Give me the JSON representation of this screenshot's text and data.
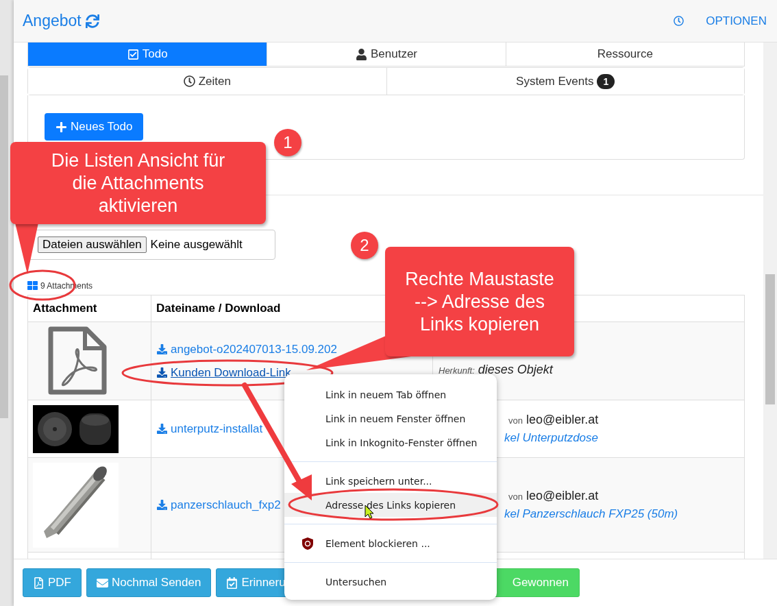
{
  "header": {
    "title": "Angebot",
    "options": "OPTIONEN"
  },
  "tabs": [
    [
      {
        "label": "Todo",
        "kind": "check",
        "selected": true
      },
      {
        "label": "Benutzer",
        "kind": "user",
        "selected": false
      },
      {
        "label": "Ressource",
        "kind": "plain",
        "selected": false
      }
    ],
    [
      {
        "label": "Zeiten",
        "kind": "clock",
        "selected": false
      },
      {
        "label": "System Events",
        "kind": "plain",
        "badge": "1",
        "selected": false
      }
    ]
  ],
  "todo_button": "Neues Todo",
  "file_input": {
    "button": "Dateien auswählen",
    "status": "Keine ausgewählt"
  },
  "attachments_count": "9 Attachments",
  "table": {
    "columns": [
      "Attachment",
      "Dateiname / Download"
    ],
    "rows": [
      {
        "kind": "pdf",
        "links": [
          {
            "text": "angebot-o202407013-15.09.202",
            "hovered": false
          },
          {
            "text": "Kunden Download-Link",
            "hovered": true
          }
        ],
        "info": {
          "kind": "origin",
          "label": "Herkunft:",
          "value": "dieses Objekt"
        }
      },
      {
        "kind": "boxes",
        "links": [
          {
            "text": "unterputz-installat",
            "hovered": false
          }
        ],
        "info": {
          "kind": "user",
          "label": "von",
          "value": "leo@eibler.at",
          "article": "kel Unterputzdose"
        }
      },
      {
        "kind": "hose",
        "links": [
          {
            "text": "panzerschlauch_fxp2",
            "hovered": false
          }
        ],
        "info": {
          "kind": "user",
          "label": "von",
          "value": "leo@eibler.at",
          "article": "kel Panzerschlauch FXP25 (50m)"
        }
      }
    ]
  },
  "footer_buttons": [
    {
      "label": "PDF",
      "kind": "pdf"
    },
    {
      "label": "Nochmal Senden",
      "kind": "mail"
    },
    {
      "label": "Erinneru",
      "kind": "calendar"
    },
    {
      "label": "Gewonnen",
      "kind": "success"
    }
  ],
  "context_menu": [
    [
      {
        "label": "Link in neuem Tab öffnen",
        "highlighted": false
      },
      {
        "label": "Link in neuem Fenster öffnen",
        "highlighted": false
      },
      {
        "label": "Link in Inkognito-Fenster öffnen",
        "highlighted": false
      }
    ],
    [
      {
        "label": "Link speichern unter...",
        "highlighted": false
      },
      {
        "label": "Adresse des Links kopieren",
        "highlighted": true
      }
    ],
    [
      {
        "label": "Element blockieren ...",
        "kind": "extension",
        "highlighted": false
      }
    ],
    [
      {
        "label": "Untersuchen",
        "highlighted": false
      }
    ]
  ],
  "callouts": [
    {
      "number": "1",
      "text": "Die Listen Ansicht für die Attachments aktivieren"
    },
    {
      "number": "2",
      "text": "Rechte Maustaste --> Adresse des Links kopieren"
    }
  ]
}
